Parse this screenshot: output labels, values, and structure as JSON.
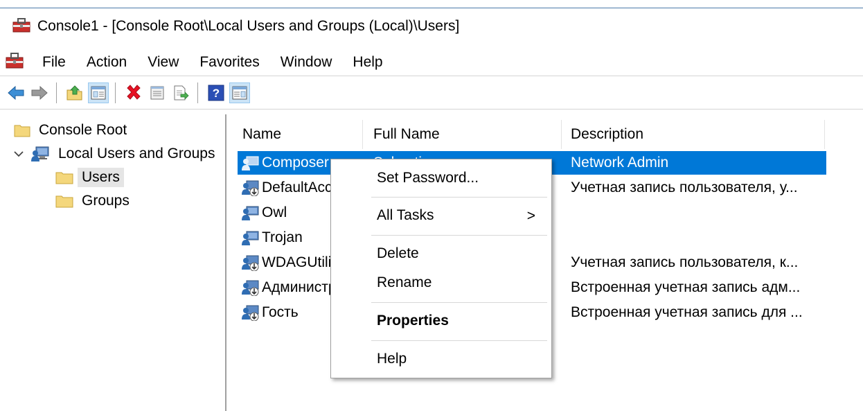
{
  "window": {
    "title": "Console1 - [Console Root\\Local Users and Groups (Local)\\Users]"
  },
  "menubar": {
    "items": [
      "File",
      "Action",
      "View",
      "Favorites",
      "Window",
      "Help"
    ]
  },
  "toolbar": {
    "buttons": [
      "back-arrow-icon",
      "forward-arrow-icon",
      "up-folder-icon",
      "show-hide-tree-icon",
      "delete-icon",
      "properties-icon",
      "export-list-icon",
      "help-icon",
      "show-hide-action-pane-icon"
    ]
  },
  "tree": {
    "items": [
      {
        "label": "Console Root",
        "icon": "folder-icon"
      },
      {
        "label": "Local Users and Groups",
        "icon": "users-computer-icon",
        "expanded": true
      },
      {
        "label": "Users",
        "icon": "folder-icon",
        "selected": true
      },
      {
        "label": "Groups",
        "icon": "folder-icon"
      }
    ]
  },
  "list": {
    "columns": [
      "Name",
      "Full Name",
      "Description"
    ],
    "rows": [
      {
        "name": "Composer",
        "fullname": "Sebastian",
        "desc": "Network Admin",
        "disabled": false,
        "selected": true
      },
      {
        "name": "DefaultAccount",
        "fullname": "",
        "desc": "Учетная запись пользователя, у...",
        "disabled": true
      },
      {
        "name": "Owl",
        "fullname": "",
        "desc": "",
        "disabled": false
      },
      {
        "name": "Trojan",
        "fullname": "",
        "desc": "",
        "disabled": false
      },
      {
        "name": "WDAGUtilityAccount",
        "fullname": "",
        "desc": "Учетная запись пользователя, к...",
        "disabled": true
      },
      {
        "name": "Администратор",
        "fullname": "",
        "desc": "Встроенная учетная запись адм...",
        "disabled": true
      },
      {
        "name": "Гость",
        "fullname": "",
        "desc": "Встроенная учетная запись для ...",
        "disabled": true
      }
    ]
  },
  "context_menu": {
    "items": [
      {
        "label": "Set Password...",
        "bold": false
      },
      {
        "label": "All Tasks",
        "bold": false,
        "submenu_arrow": ">"
      },
      {
        "label": "Delete",
        "bold": false
      },
      {
        "label": "Rename",
        "bold": false
      },
      {
        "label": "Properties",
        "bold": true
      },
      {
        "label": "Help",
        "bold": false
      }
    ]
  },
  "colors": {
    "selection": "#0078d7",
    "tree_selection": "#e5e5e5",
    "toolbar_pressed": "#cce4f7",
    "delete_red": "#e81123",
    "help_blue": "#2b4fb5",
    "folder_yellow": "#f4d77c"
  }
}
